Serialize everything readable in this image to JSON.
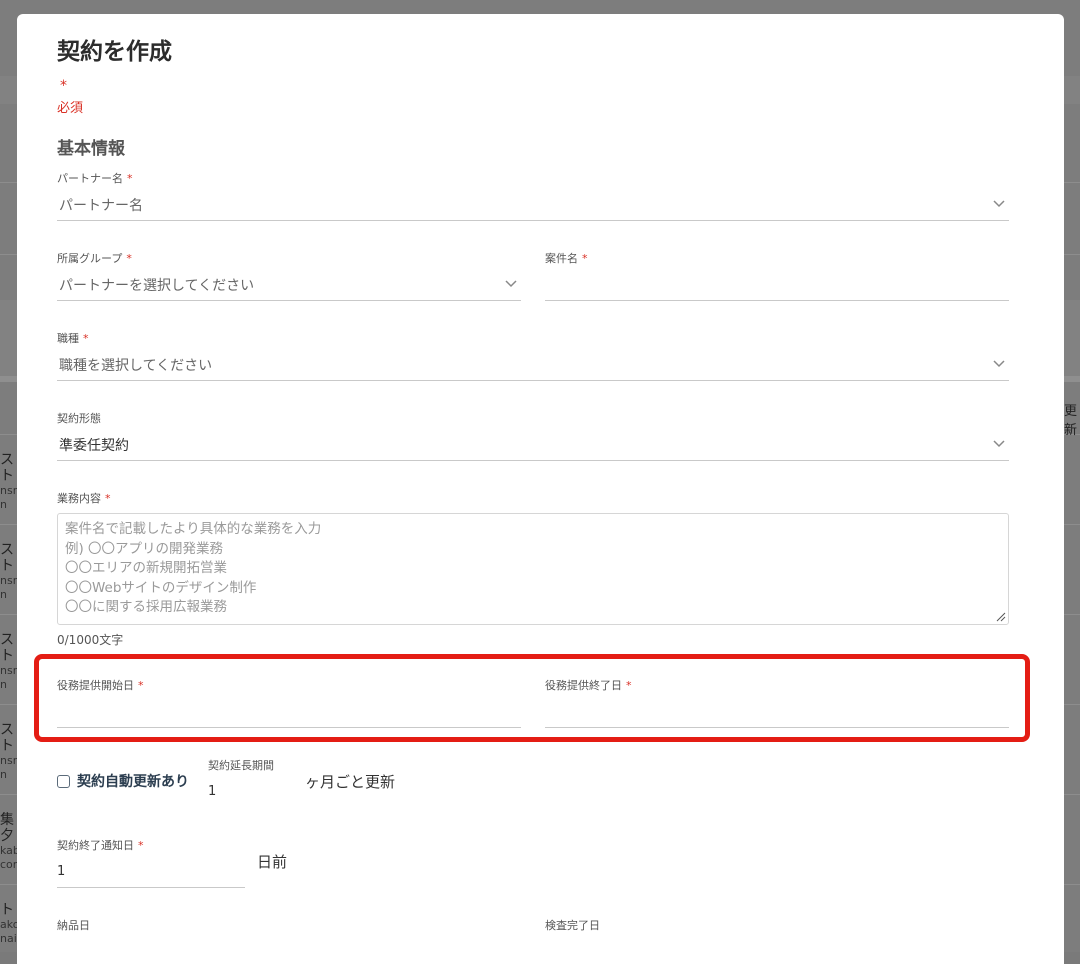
{
  "modal": {
    "title": "契約を作成",
    "required_star": "*",
    "required_note": "必須",
    "section_basic": "基本情報"
  },
  "fields": {
    "partner": {
      "label": "パートナー名",
      "star": "*",
      "placeholder": "パートナー名"
    },
    "group": {
      "label": "所属グループ",
      "star": "*",
      "placeholder": "パートナーを選択してください"
    },
    "project": {
      "label": "案件名",
      "star": "*",
      "value": ""
    },
    "job_type": {
      "label": "職種",
      "star": "*",
      "placeholder": "職種を選択してください"
    },
    "contract_type": {
      "label": "契約形態",
      "value": "準委任契約"
    },
    "work_content": {
      "label": "業務内容",
      "star": "*",
      "placeholder_lines": [
        "案件名で記載したより具体的な業務を入力",
        "例) 〇〇アプリの開発業務",
        "〇〇エリアの新規開拓営業",
        "〇〇Webサイトのデザイン制作",
        "〇〇に関する採用広報業務"
      ],
      "counter": "0/1000文字"
    },
    "service_start": {
      "label": "役務提供開始日",
      "star": "*",
      "value": ""
    },
    "service_end": {
      "label": "役務提供終了日",
      "star": "*",
      "value": ""
    },
    "auto_renew": {
      "label": "契約自動更新あり",
      "checked": false
    },
    "extension": {
      "label": "契約延長期間",
      "value": "1",
      "unit": "ヶ月ごと更新"
    },
    "notice": {
      "label": "契約終了通知日",
      "star": "*",
      "value": "1",
      "unit": "日前"
    },
    "delivery_date": {
      "label": "納品日"
    },
    "inspection_date": {
      "label": "検査完了日"
    }
  },
  "background": {
    "left_rows": [
      {
        "main": "スト",
        "sub1": "nsm",
        "sub2": "n"
      },
      {
        "main": "スト",
        "sub1": "nsm",
        "sub2": "n"
      },
      {
        "main": "スト",
        "sub1": "nsm",
        "sub2": "n"
      },
      {
        "main": "スト",
        "sub1": "nsm",
        "sub2": "n"
      },
      {
        "main": "集夕",
        "sub1": "kab",
        "sub2": "con"
      },
      {
        "main": "ト",
        "sub1": "ako",
        "sub2": "nail"
      }
    ],
    "right_header": "更新"
  },
  "colors": {
    "required": "#d93025",
    "highlight": "#e41d14",
    "overlay": "#7d7d7d"
  },
  "icons": {
    "dropdown": "chevron-down-icon",
    "checkbox": "checkbox-unchecked-icon",
    "resize": "resize-grip-icon"
  }
}
